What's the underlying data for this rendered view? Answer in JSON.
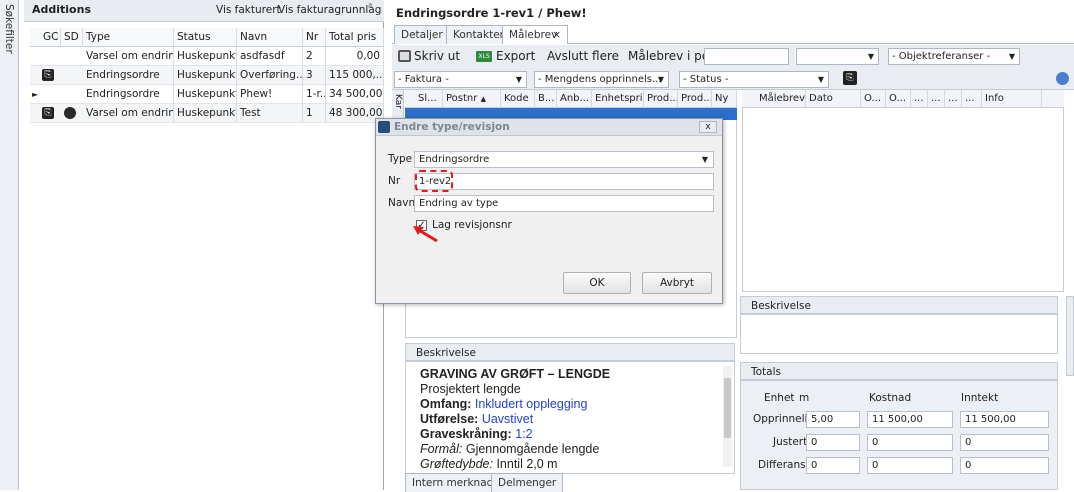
{
  "sidebar": {
    "label": "Søkefilter"
  },
  "left": {
    "title": "Additions",
    "vis_fakturert": "Vis fakturert",
    "vis_grunnlag": "Vis fakturagrunnlag",
    "pin": "ª",
    "columns": [
      "GC",
      "SD",
      "Type",
      "Status",
      "Navn",
      "Nr",
      "Total pris"
    ],
    "rows": [
      {
        "type": "Varsel om endring",
        "status": "Huskepunkt",
        "navn": "asdfasdf",
        "nr": "2",
        "total": "0,00"
      },
      {
        "type": "Endringsordre",
        "status": "Huskepunkt",
        "navn": "Overføring...",
        "nr": "3",
        "total": "115 000,..."
      },
      {
        "type": "Endringsordre",
        "status": "Huskepunkt",
        "navn": "Phew!",
        "nr": "1-r...",
        "total": "34 500,00"
      },
      {
        "type": "Varsel om endring",
        "status": "Huskepunkt",
        "navn": "Test",
        "nr": "1",
        "total": "48 300,00"
      }
    ]
  },
  "right": {
    "title": "Endringsordre 1-rev1 / Phew!",
    "tabs": [
      "Detaljer",
      "Kontakter",
      "Målebrev"
    ],
    "tab_close": "×",
    "toolbar": {
      "print": "Skriv ut",
      "export": "Export",
      "close_all": "Avslutt flere",
      "period": "Målebrev i periode",
      "objref": "- Objektreferanser -"
    },
    "filters": {
      "faktura": "- Faktura -",
      "mengder": "- Mengdens opprinnels...",
      "status": "- Status -"
    },
    "grid_cols": [
      "Sl...",
      "Postnr",
      "Kode",
      "B...",
      "Anb...",
      "Enhetspris",
      "Prod...",
      "Prod...",
      "Ny"
    ],
    "grid_sort": "▲",
    "grid_side": "Kar",
    "mb_cols": [
      "Målebrev",
      "Dato",
      "O...",
      "O...",
      "...",
      "...",
      "...",
      "...",
      "Info"
    ],
    "beskrivelse_label": "Beskrivelse",
    "beskrivelse2_label": "Beskrivelse",
    "desc": {
      "title": "GRAVING AV GRØFT – LENGDE",
      "line1": "Prosjektert lengde",
      "omfang_k": "Omfang:",
      "omfang_v": "Inkludert opplegging",
      "utf_k": "Utførelse:",
      "utf_v": "Uavstivet",
      "grav_k": "Graveskråning:",
      "grav_v": "1:2",
      "formal_k": "Formål:",
      "formal_v": "Gjennomgående lengde",
      "dybde_k": "Grøftedybde:",
      "dybde_v": "Inntil 2,0 m"
    },
    "bottom_tabs": [
      "Intern merknad",
      "Delmenger"
    ],
    "totals": {
      "header": "Totals",
      "enhet_label": "Enhet",
      "enhet": "m",
      "kostnad": "Kostnad",
      "inntekt": "Inntekt",
      "rows": [
        {
          "label": "Opprinnelig",
          "enhet": "5,00",
          "kostnad": "11 500,00",
          "inntekt": "11 500,00"
        },
        {
          "label": "Justert",
          "enhet": "0",
          "kostnad": "0",
          "inntekt": "0"
        },
        {
          "label": "Differanse",
          "enhet": "0",
          "kostnad": "0",
          "inntekt": "0"
        }
      ]
    }
  },
  "dialog": {
    "title": "Endre type/revisjon",
    "close": "x",
    "type_label": "Type",
    "type_value": "Endringsordre",
    "nr_label": "Nr",
    "nr_value": "1-rev2",
    "navn_label": "Navn",
    "navn_value": "Endring av type",
    "checkbox_label": "Lag revisjonsnr",
    "checked": "✓",
    "ok": "OK",
    "cancel": "Avbryt"
  },
  "colors": {
    "accent": "#2a6fc9",
    "highlight": "#e21b1b"
  }
}
